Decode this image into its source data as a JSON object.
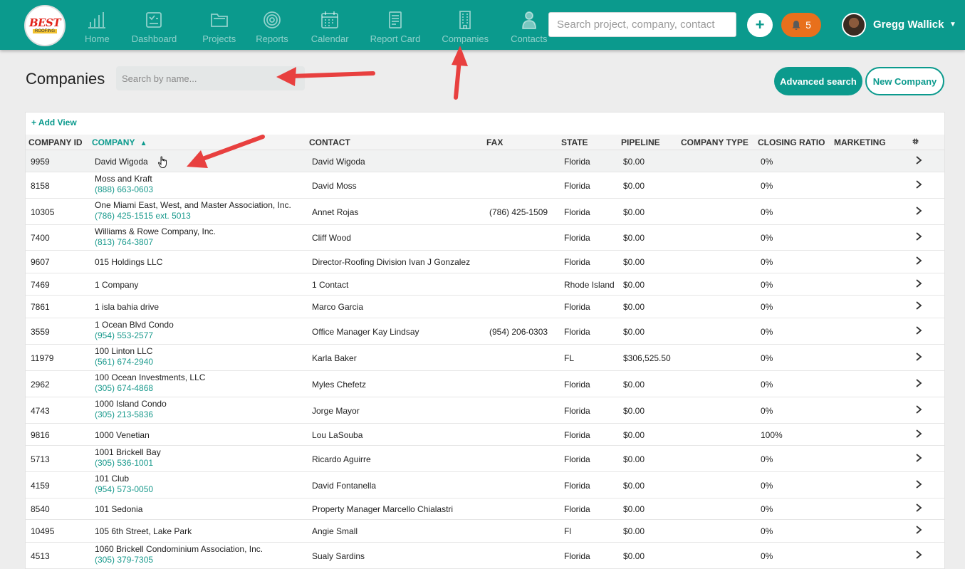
{
  "brand": {
    "logo_text_top": "BEST",
    "logo_text_bottom": "ROOFING"
  },
  "nav": [
    {
      "label": "Home",
      "icon": "bar-chart-icon"
    },
    {
      "label": "Dashboard",
      "icon": "dashboard-icon"
    },
    {
      "label": "Projects",
      "icon": "folder-icon"
    },
    {
      "label": "Reports",
      "icon": "target-icon"
    },
    {
      "label": "Calendar",
      "icon": "calendar-icon"
    },
    {
      "label": "Report Card",
      "icon": "report-card-icon"
    },
    {
      "label": "Companies",
      "icon": "building-icon"
    },
    {
      "label": "Contacts",
      "icon": "person-icon"
    }
  ],
  "header_search": {
    "placeholder": "Search project, company, contact"
  },
  "notifications": {
    "count": "5"
  },
  "user": {
    "name": "Gregg Wallick"
  },
  "page": {
    "title": "Companies",
    "search_placeholder": "Search by name...",
    "advanced_search_label": "Advanced search",
    "new_company_label": "New Company",
    "add_view_label": "+ Add View"
  },
  "columns": {
    "company_id": "COMPANY ID",
    "company": "COMPANY",
    "contact": "CONTACT",
    "fax": "FAX",
    "state": "STATE",
    "pipeline": "PIPELINE",
    "company_type": "COMPANY TYPE",
    "closing_ratio": "CLOSING RATIO",
    "marketing": "MARKETING"
  },
  "rows": [
    {
      "id": "9959",
      "company": "David Wigoda",
      "phone": "",
      "contact": "David Wigoda",
      "fax": "",
      "state": "Florida",
      "pipeline": "$0.00",
      "closing_ratio": "0%"
    },
    {
      "id": "8158",
      "company": "Moss and Kraft",
      "phone": "(888) 663-0603",
      "contact": "David Moss",
      "fax": "",
      "state": "Florida",
      "pipeline": "$0.00",
      "closing_ratio": "0%"
    },
    {
      "id": "10305",
      "company": "One Miami East, West, and Master Association, Inc.",
      "phone": "(786) 425-1515 ext. 5013",
      "contact": "Annet Rojas",
      "fax": "(786) 425-1509",
      "state": "Florida",
      "pipeline": "$0.00",
      "closing_ratio": "0%"
    },
    {
      "id": "7400",
      "company": "Williams & Rowe Company, Inc.",
      "phone": "(813) 764-3807",
      "contact": "Cliff Wood",
      "fax": "",
      "state": "Florida",
      "pipeline": "$0.00",
      "closing_ratio": "0%"
    },
    {
      "id": "9607",
      "company": "015 Holdings LLC",
      "phone": "",
      "contact": "Director-Roofing Division Ivan J Gonzalez",
      "fax": "",
      "state": "Florida",
      "pipeline": "$0.00",
      "closing_ratio": "0%"
    },
    {
      "id": "7469",
      "company": "1 Company",
      "phone": "",
      "contact": "1 Contact",
      "fax": "",
      "state": "Rhode Island",
      "pipeline": "$0.00",
      "closing_ratio": "0%"
    },
    {
      "id": "7861",
      "company": "1 isla bahia drive",
      "phone": "",
      "contact": "Marco Garcia",
      "fax": "",
      "state": "Florida",
      "pipeline": "$0.00",
      "closing_ratio": "0%"
    },
    {
      "id": "3559",
      "company": "1 Ocean Blvd Condo",
      "phone": "(954) 553-2577",
      "contact": "Office Manager Kay Lindsay",
      "fax": "(954) 206-0303",
      "state": "Florida",
      "pipeline": "$0.00",
      "closing_ratio": "0%"
    },
    {
      "id": "11979",
      "company": "100 Linton LLC",
      "phone": "(561) 674-2940",
      "contact": "Karla Baker",
      "fax": "",
      "state": "FL",
      "pipeline": "$306,525.50",
      "closing_ratio": "0%"
    },
    {
      "id": "2962",
      "company": "100 Ocean Investments, LLC",
      "phone": "(305) 674-4868",
      "contact": "Myles Chefetz",
      "fax": "",
      "state": "Florida",
      "pipeline": "$0.00",
      "closing_ratio": "0%"
    },
    {
      "id": "4743",
      "company": "1000 Island Condo",
      "phone": "(305) 213-5836",
      "contact": "Jorge Mayor",
      "fax": "",
      "state": "Florida",
      "pipeline": "$0.00",
      "closing_ratio": "0%"
    },
    {
      "id": "9816",
      "company": "1000 Venetian",
      "phone": "",
      "contact": "Lou LaSouba",
      "fax": "",
      "state": "Florida",
      "pipeline": "$0.00",
      "closing_ratio": "100%"
    },
    {
      "id": "5713",
      "company": "1001 Brickell Bay",
      "phone": "(305) 536-1001",
      "contact": "Ricardo Aguirre",
      "fax": "",
      "state": "Florida",
      "pipeline": "$0.00",
      "closing_ratio": "0%"
    },
    {
      "id": "4159",
      "company": "101 Club",
      "phone": "(954) 573-0050",
      "contact": "David Fontanella",
      "fax": "",
      "state": "Florida",
      "pipeline": "$0.00",
      "closing_ratio": "0%"
    },
    {
      "id": "8540",
      "company": "101 Sedonia",
      "phone": "",
      "contact": "Property Manager Marcello Chialastri",
      "fax": "",
      "state": "Florida",
      "pipeline": "$0.00",
      "closing_ratio": "0%"
    },
    {
      "id": "10495",
      "company": "105 6th Street, Lake Park",
      "phone": "",
      "contact": "Angie Small",
      "fax": "",
      "state": "Fl",
      "pipeline": "$0.00",
      "closing_ratio": "0%"
    },
    {
      "id": "4513",
      "company": "1060 Brickell Condominium Association, Inc.",
      "phone": "(305) 379-7305",
      "contact": "Sualy Sardins",
      "fax": "",
      "state": "Florida",
      "pipeline": "$0.00",
      "closing_ratio": "0%"
    }
  ],
  "colors": {
    "primary": "#0b9a8d",
    "notification": "#e8701c",
    "annotation_arrow": "#e8403f"
  }
}
